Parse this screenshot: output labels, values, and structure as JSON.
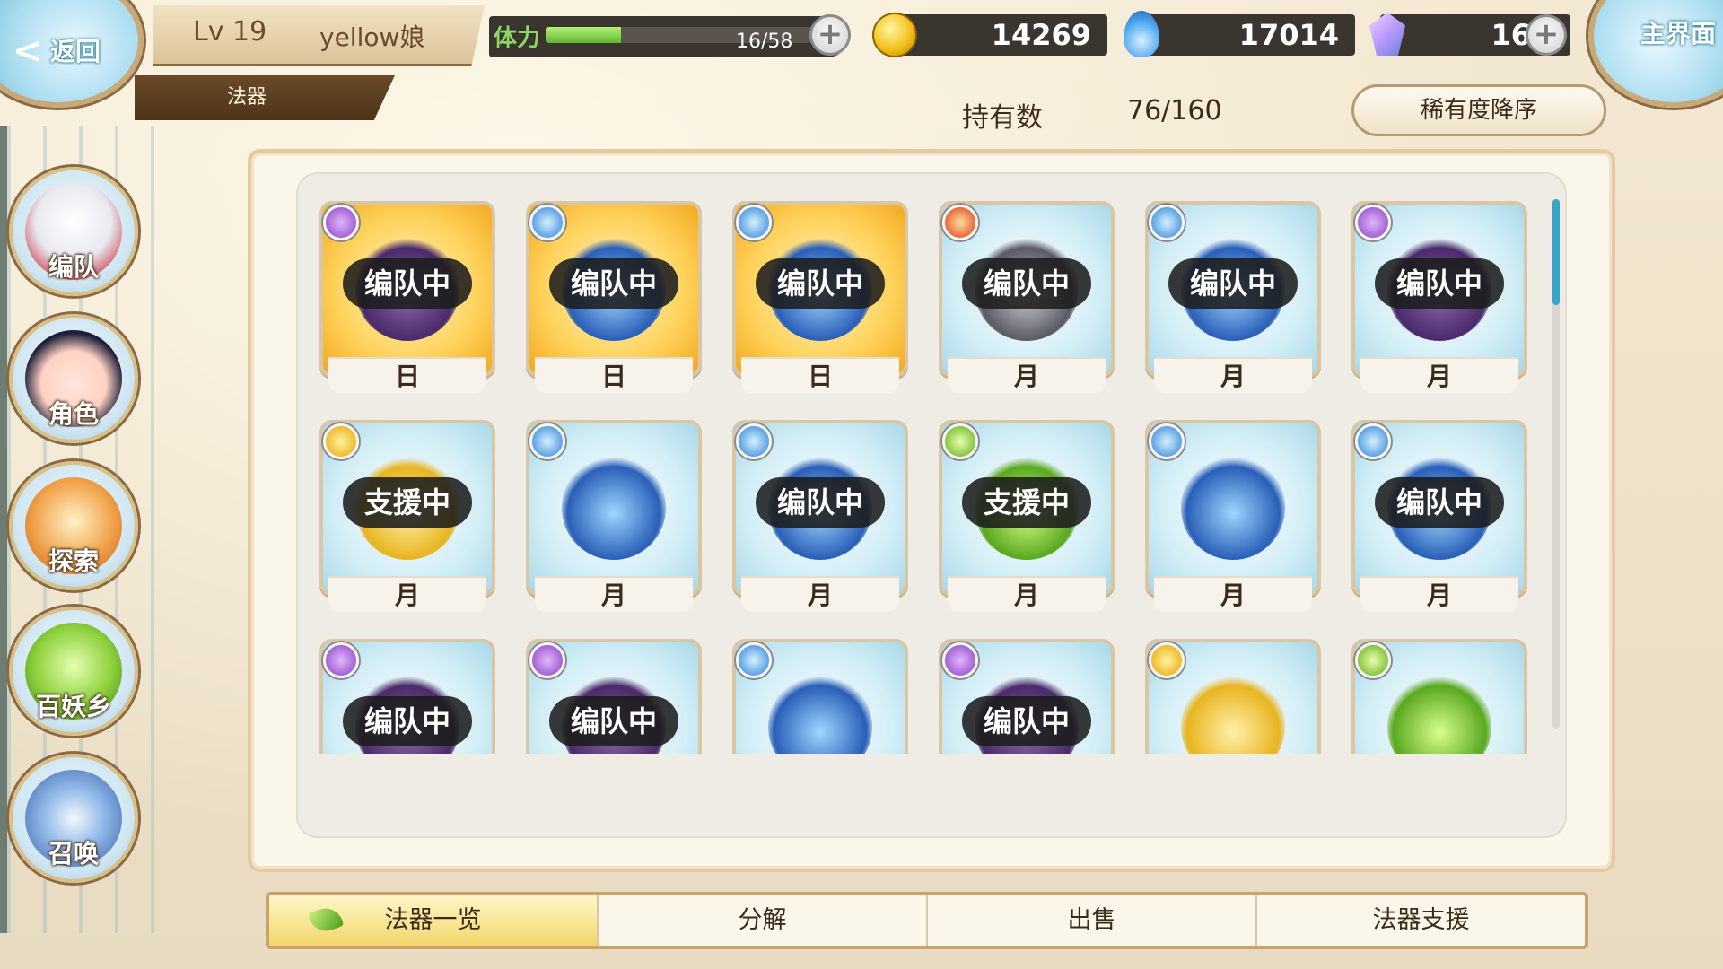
{
  "header": {
    "back_label": "返回",
    "home_label": "主界面",
    "player_level": "Lv 19",
    "player_name": "yellow娘",
    "section_title": "法器",
    "stamina_label": "体力",
    "stamina_text": "16/58",
    "stamina_fraction": 0.28,
    "gold": "14269",
    "soul": "17014",
    "gems": "16"
  },
  "inventory": {
    "owned_label": "持有数",
    "owned_value": "76/160",
    "sort_label": "稀有度降序"
  },
  "sidebar": {
    "items": [
      {
        "label": "编队"
      },
      {
        "label": "角色"
      },
      {
        "label": "探索"
      },
      {
        "label": "百妖乡"
      },
      {
        "label": "召唤"
      }
    ]
  },
  "artifacts": [
    {
      "element": "purple",
      "status": "编队中",
      "rank": "日",
      "frame": "sun"
    },
    {
      "element": "blue",
      "status": "编队中",
      "rank": "日",
      "frame": "sun"
    },
    {
      "element": "blue",
      "status": "编队中",
      "rank": "日",
      "frame": "sun"
    },
    {
      "element": "red",
      "status": "编队中",
      "rank": "月",
      "frame": "moon"
    },
    {
      "element": "blue",
      "status": "编队中",
      "rank": "月",
      "frame": "moon"
    },
    {
      "element": "purple",
      "status": "编队中",
      "rank": "月",
      "frame": "moon"
    },
    {
      "element": "gold",
      "status": "支援中",
      "rank": "月",
      "frame": "moon"
    },
    {
      "element": "blue",
      "status": "",
      "rank": "月",
      "frame": "moon"
    },
    {
      "element": "blue",
      "status": "编队中",
      "rank": "月",
      "frame": "moon"
    },
    {
      "element": "green",
      "status": "支援中",
      "rank": "月",
      "frame": "moon"
    },
    {
      "element": "blue",
      "status": "",
      "rank": "月",
      "frame": "moon"
    },
    {
      "element": "blue",
      "status": "编队中",
      "rank": "月",
      "frame": "moon"
    },
    {
      "element": "purple",
      "status": "编队中",
      "rank": "",
      "frame": "moon"
    },
    {
      "element": "purple",
      "status": "编队中",
      "rank": "",
      "frame": "moon"
    },
    {
      "element": "blue",
      "status": "",
      "rank": "",
      "frame": "moon"
    },
    {
      "element": "purple",
      "status": "编队中",
      "rank": "",
      "frame": "moon"
    },
    {
      "element": "gold",
      "status": "",
      "rank": "",
      "frame": "moon"
    },
    {
      "element": "green",
      "status": "",
      "rank": "",
      "frame": "moon"
    }
  ],
  "tabs": [
    {
      "label": "法器一览",
      "active": true
    },
    {
      "label": "分解",
      "active": false
    },
    {
      "label": "出售",
      "active": false
    },
    {
      "label": "法器支援",
      "active": false
    }
  ],
  "colors": {
    "accent_gold": "#f2d66a",
    "frame_border": "#d8c6a4",
    "status_badge": "#1c1c1c"
  }
}
